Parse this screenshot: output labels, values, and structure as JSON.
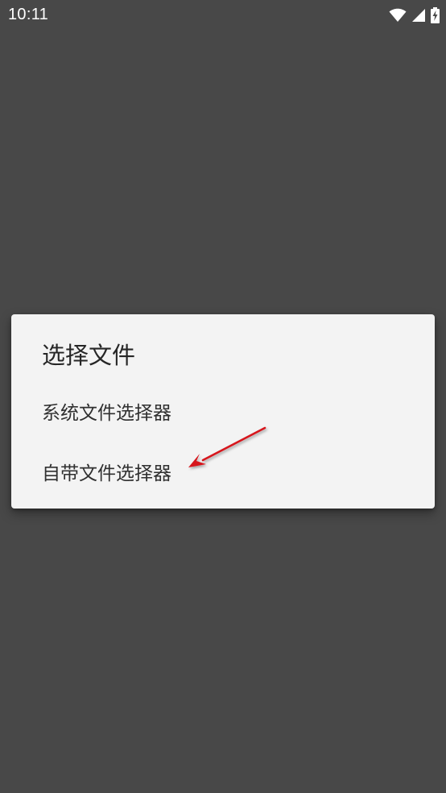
{
  "status_bar": {
    "time": "10:11",
    "icons": [
      "wifi-icon",
      "cell-signal-icon",
      "battery-charging-icon"
    ]
  },
  "dialog": {
    "title": "选择文件",
    "options": [
      {
        "label": "系统文件选择器"
      },
      {
        "label": "自带文件选择器"
      }
    ]
  },
  "colors": {
    "scrim": "#484848",
    "dialog_bg": "#f3f3f3",
    "title_text": "#262626",
    "option_text": "#303030",
    "annotation_arrow": "#d6161e"
  }
}
